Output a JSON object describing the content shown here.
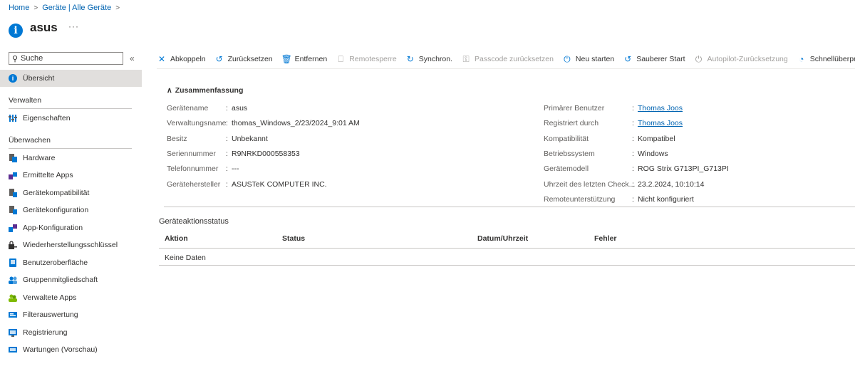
{
  "breadcrumb": {
    "home": "Home",
    "devices": "Geräte | Alle Geräte"
  },
  "page": {
    "title": "asus",
    "more": "···"
  },
  "sidebar": {
    "search_placeholder": "Suche",
    "collapse": "«",
    "overview": "Übersicht",
    "section_manage": "Verwalten",
    "properties": "Eigenschaften",
    "section_monitor": "Überwachen",
    "items": [
      "Hardware",
      "Ermittelte Apps",
      "Gerätekompatibilität",
      "Gerätekonfiguration",
      "App-Konfiguration",
      "Wiederherstellungsschlüssel",
      "Benutzeroberfläche",
      "Gruppenmitgliedschaft",
      "Verwaltete Apps",
      "Filterauswertung",
      "Registrierung",
      "Wartungen (Vorschau)"
    ]
  },
  "toolbar": {
    "abkoppeln": "Abkoppeln",
    "zuruecksetzen": "Zurücksetzen",
    "entfernen": "Entfernen",
    "remotesperre": "Remotesperre",
    "synchron": "Synchron.",
    "passcode": "Passcode zurücksetzen",
    "neustarten": "Neu starten",
    "sauberer": "Sauberer Start",
    "autopilot": "Autopilot-Zurücksetzung",
    "schnell": "Schnellüberprüfung",
    "more": "···"
  },
  "summary": {
    "heading": "Zusammenfassung",
    "left": [
      {
        "k": "Gerätename",
        "v": "asus"
      },
      {
        "k": "Verwaltungsname",
        "v": "thomas_Windows_2/23/2024_9:01 AM"
      },
      {
        "k": "Besitz",
        "v": "Unbekannt"
      },
      {
        "k": "Seriennummer",
        "v": "R9NRKD000558353"
      },
      {
        "k": "Telefonnummer",
        "v": "---"
      },
      {
        "k": "Gerätehersteller",
        "v": "ASUSTeK COMPUTER INC."
      }
    ],
    "right": [
      {
        "k": "Primärer Benutzer",
        "v": "Thomas Joos"
      },
      {
        "k": "Registriert durch",
        "v": "Thomas Joos"
      },
      {
        "k": "Kompatibilität",
        "v": "Kompatibel"
      },
      {
        "k": "Betriebssystem",
        "v": "Windows"
      },
      {
        "k": "Gerätemodell",
        "v": "ROG Strix G713PI_G713PI"
      },
      {
        "k": "Uhrzeit des letzten Check...",
        "v": "23.2.2024, 10:10:14"
      },
      {
        "k": "Remoteunterstützung",
        "v": "Nicht konfiguriert"
      }
    ]
  },
  "status": {
    "title": "Geräteaktionsstatus",
    "columns": [
      "Aktion",
      "Status",
      "Datum/Uhrzeit",
      "Fehler"
    ],
    "empty": "Keine Daten"
  },
  "colors": {
    "accent": "#0078d4",
    "link": "#0063b1"
  }
}
